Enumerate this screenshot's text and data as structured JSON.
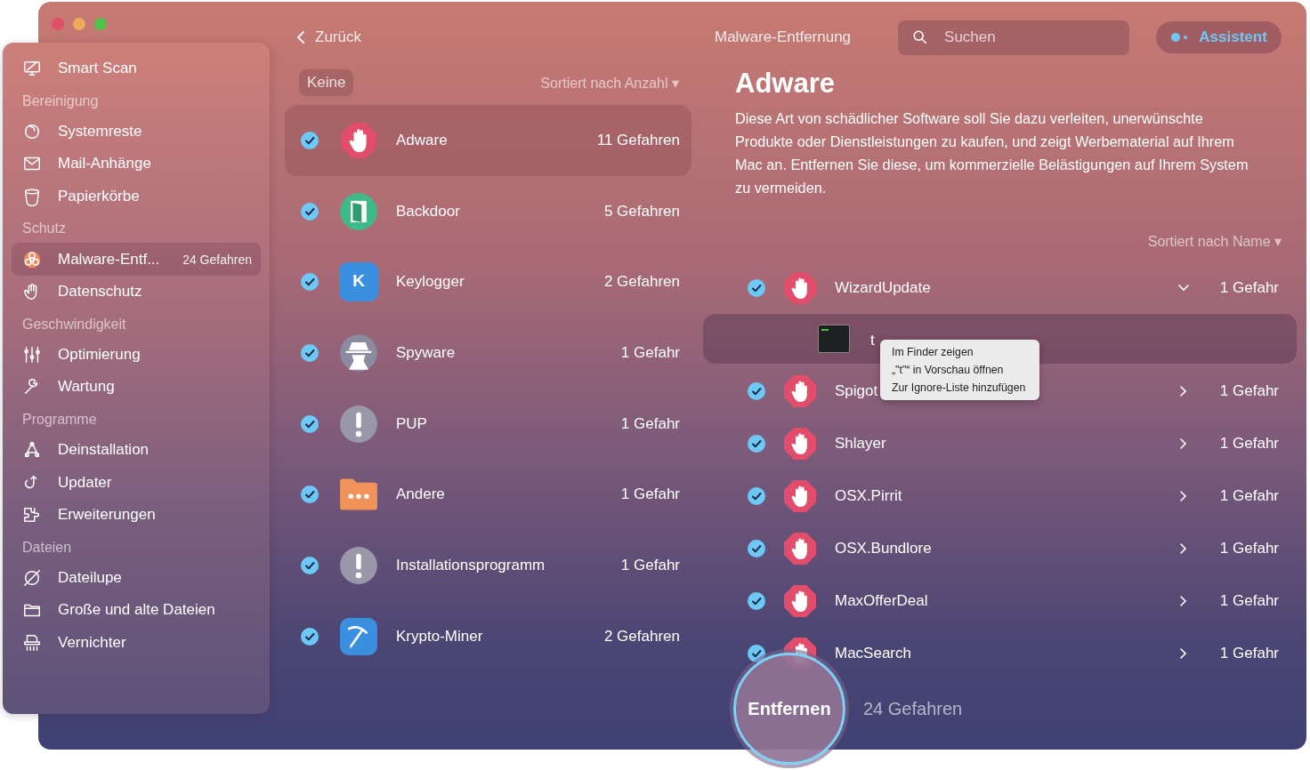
{
  "window": {
    "title": "Malware-Entfernung"
  },
  "sidebar": {
    "top_items": [
      {
        "label": "Smart Scan",
        "selected": false
      }
    ],
    "sections": [
      {
        "title": "Bereinigung",
        "items": [
          {
            "label": "Systemreste",
            "selected": false
          },
          {
            "label": "Mail-Anhänge",
            "selected": false
          },
          {
            "label": "Papierkörbe",
            "selected": false
          }
        ]
      },
      {
        "title": "Schutz",
        "items": [
          {
            "label": "Malware-Entf...",
            "selected": true,
            "badge": "24 Gefahren"
          },
          {
            "label": "Datenschutz",
            "selected": false
          }
        ]
      },
      {
        "title": "Geschwindigkeit",
        "items": [
          {
            "label": "Optimierung",
            "selected": false
          },
          {
            "label": "Wartung",
            "selected": false
          }
        ]
      },
      {
        "title": "Programme",
        "items": [
          {
            "label": "Deinstallation",
            "selected": false
          },
          {
            "label": "Updater",
            "selected": false
          },
          {
            "label": "Erweiterungen",
            "selected": false
          }
        ]
      },
      {
        "title": "Dateien",
        "items": [
          {
            "label": "Dateilupe",
            "selected": false
          },
          {
            "label": "Große und alte Dateien",
            "selected": false
          },
          {
            "label": "Vernichter",
            "selected": false
          }
        ]
      }
    ]
  },
  "back_button": "Zurück",
  "filter_button": "Keine",
  "category_sort": "Sortiert nach Anzahl ▾",
  "categories": [
    {
      "name": "Adware",
      "count": "11 Gefahren",
      "checked": true,
      "selected": true
    },
    {
      "name": "Backdoor",
      "count": "5 Gefahren",
      "checked": true,
      "selected": false
    },
    {
      "name": "Keylogger",
      "count": "2 Gefahren",
      "glyph": "K",
      "checked": true,
      "selected": false
    },
    {
      "name": "Spyware",
      "count": "1 Gefahr",
      "checked": true,
      "selected": false
    },
    {
      "name": "PUP",
      "count": "1 Gefahr",
      "checked": true,
      "selected": false
    },
    {
      "name": "Andere",
      "count": "1 Gefahr",
      "checked": true,
      "selected": false
    },
    {
      "name": "Installationsprogramm",
      "count": "1 Gefahr",
      "checked": true,
      "selected": false
    },
    {
      "name": "Krypto-Miner",
      "count": "2 Gefahren",
      "checked": true,
      "selected": false
    }
  ],
  "search": {
    "placeholder": "Suchen"
  },
  "assistant_button": "Assistent",
  "detail": {
    "title": "Adware",
    "description": "Diese Art von schädlicher Software soll Sie dazu verleiten, unerwünschte Produkte oder Dienstleistungen zu kaufen, und zeigt Werbematerial auf Ihrem Mac an. Entfernen Sie diese, um kommerzielle Belästigungen auf Ihrem System zu vermeiden.",
    "sort": "Sortiert nach Name ▾"
  },
  "threats": [
    {
      "name": "WizardUpdate",
      "count": "1 Gefahr",
      "checked": true,
      "expanded": true,
      "children": [
        {
          "name": "t",
          "selected": true
        }
      ]
    },
    {
      "name": "Spigot",
      "count": "1 Gefahr",
      "checked": true,
      "expanded": false
    },
    {
      "name": "Shlayer",
      "count": "1 Gefahr",
      "checked": true,
      "expanded": false
    },
    {
      "name": "OSX.Pirrit",
      "count": "1 Gefahr",
      "checked": true,
      "expanded": false
    },
    {
      "name": "OSX.Bundlore",
      "count": "1 Gefahr",
      "checked": true,
      "expanded": false
    },
    {
      "name": "MaxOfferDeal",
      "count": "1 Gefahr",
      "checked": true,
      "expanded": false
    },
    {
      "name": "MacSearch",
      "count": "1 Gefahr",
      "checked": true,
      "expanded": false
    }
  ],
  "context_menu": [
    "Im Finder zeigen",
    "„\"t\"“ in Vorschau öffnen",
    "Zur Ignore-Liste hinzufügen"
  ],
  "remove_button": "Entfernen",
  "total": "24 Gefahren"
}
